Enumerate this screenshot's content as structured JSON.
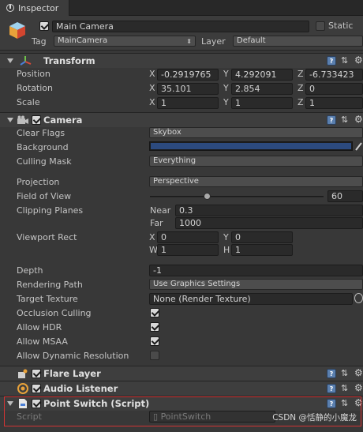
{
  "window": {
    "tab_label": "Inspector"
  },
  "header": {
    "name": "Main Camera",
    "static_label": "Static",
    "tag_label": "Tag",
    "tag_value": "MainCamera",
    "layer_label": "Layer",
    "layer_value": "Default"
  },
  "transform": {
    "title": "Transform",
    "position_label": "Position",
    "rotation_label": "Rotation",
    "scale_label": "Scale",
    "axes": [
      "X",
      "Y",
      "Z"
    ],
    "position": [
      "-0.2919765",
      "4.292091",
      "-6.733423"
    ],
    "rotation": [
      "35.101",
      "2.854",
      "0"
    ],
    "scale": [
      "1",
      "1",
      "1"
    ]
  },
  "camera": {
    "title": "Camera",
    "clear_flags_label": "Clear Flags",
    "clear_flags_value": "Skybox",
    "background_label": "Background",
    "background_color": "#2c4a7e",
    "culling_mask_label": "Culling Mask",
    "culling_mask_value": "Everything",
    "projection_label": "Projection",
    "projection_value": "Perspective",
    "fov_label": "Field of View",
    "fov_value": "60",
    "clipping_label": "Clipping Planes",
    "near_label": "Near",
    "near_value": "0.3",
    "far_label": "Far",
    "far_value": "1000",
    "viewport_label": "Viewport Rect",
    "vp_x_label": "X",
    "vp_x": "0",
    "vp_y_label": "Y",
    "vp_y": "0",
    "vp_w_label": "W",
    "vp_w": "1",
    "vp_h_label": "H",
    "vp_h": "1",
    "depth_label": "Depth",
    "depth_value": "-1",
    "rendering_path_label": "Rendering Path",
    "rendering_path_value": "Use Graphics Settings",
    "target_texture_label": "Target Texture",
    "target_texture_value": "None (Render Texture)",
    "occlusion_label": "Occlusion Culling",
    "hdr_label": "Allow HDR",
    "msaa_label": "Allow MSAA",
    "dynamic_res_label": "Allow Dynamic Resolution"
  },
  "flare_layer": {
    "title": "Flare Layer"
  },
  "audio_listener": {
    "title": "Audio Listener"
  },
  "point_switch": {
    "title": "Point Switch (Script)",
    "script_label": "Script",
    "script_value": "PointSwitch"
  },
  "watermark": "CSDN @恬静的小魔龙"
}
